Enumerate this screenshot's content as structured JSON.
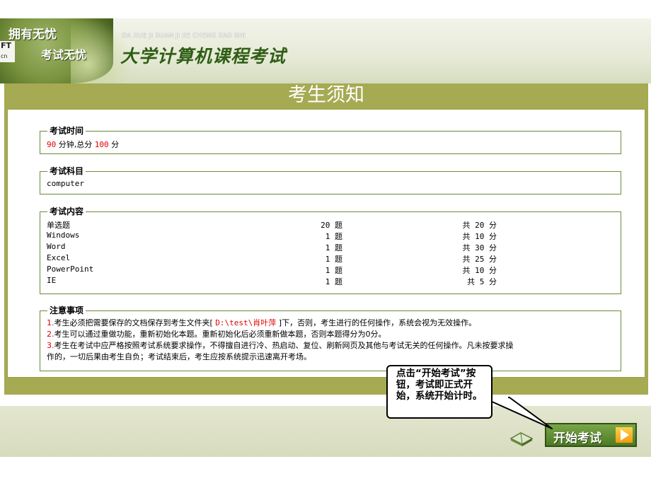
{
  "banner": {
    "slogan_line1": "拥有无忧",
    "slogan_line2": "考试无忧",
    "logo_fragment": "FT",
    "logo_fragment_sub": "cn",
    "pinyin": "DA XUE JI SUAN JI KE CHENG KAO SHI",
    "title": "大学计算机课程考试"
  },
  "panel": {
    "title": "考生须知"
  },
  "exam_time": {
    "legend": "考试时间",
    "minutes": "90",
    "minutes_unit": " 分钟,总分 ",
    "total_score": "100",
    "score_unit": " 分"
  },
  "exam_subject": {
    "legend": "考试科目",
    "value": "computer"
  },
  "exam_content": {
    "legend": "考试内容",
    "rows": [
      {
        "name": "单选题",
        "count": "20 题",
        "score": "共 20 分"
      },
      {
        "name": "Windows",
        "count": "1 题",
        "score": "共 10 分"
      },
      {
        "name": "Word",
        "count": "1 题",
        "score": "共 30 分"
      },
      {
        "name": "Excel",
        "count": "1 题",
        "score": "共 25 分"
      },
      {
        "name": "PowerPoint",
        "count": "1 题",
        "score": "共 10 分"
      },
      {
        "name": "IE",
        "count": "1 题",
        "score": "共 5 分"
      }
    ]
  },
  "notes": {
    "legend": "注意事项",
    "n1_num": "1.",
    "n1_a": "考生必须把需要保存的文档保存到考生文件夹[ ",
    "n1_path": "D:\\test\\肖叶萍",
    "n1_b": " ]下，否则，考生进行的任何操作，系统会视为无效操作。",
    "n2_num": "2.",
    "n2": "考生可以通过重做功能，重新初始化本题。重新初始化后必须重新做本题，否则本题得分为0分。",
    "n3_num": "3.",
    "n3_a": "考生在考试中应严格按照考试系统要求操作，不得擅自进行冷、热启动、复位、刷新网页及其他与考试无关的任何操作。凡未按要求操",
    "n3_b": "作的，一切后果由考生自负；考试结束后，考生应按系统提示迅速离开考场。"
  },
  "callout": {
    "text": "点击“开始考试”按钮，考试即正式开始，系统开始计时。"
  },
  "start_button": {
    "label": "开始考试"
  },
  "icons": {
    "start_arrow": "play-arrow-icon",
    "book": "book-icon"
  },
  "colors": {
    "panel": "#a6aa52",
    "highlight": "#e00000",
    "button": "#4e7a24"
  }
}
